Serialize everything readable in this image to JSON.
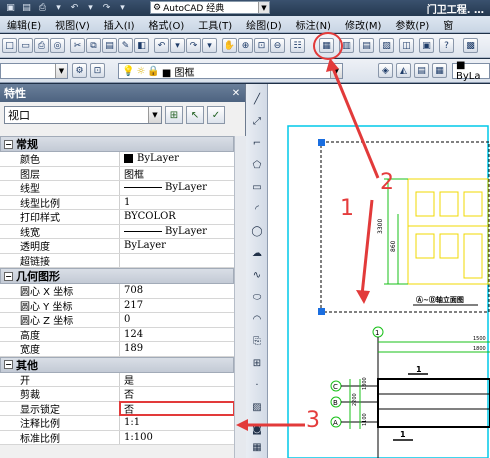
{
  "title_bar": {
    "workspace": "AutoCAD 经典",
    "title": "门卫工程. …"
  },
  "menu": [
    "编辑(E)",
    "视图(V)",
    "插入(I)",
    "格式(O)",
    "工具(T)",
    "绘图(D)",
    "标注(N)",
    "修改(M)",
    "参数(P)",
    "窗"
  ],
  "toolbar2": {
    "layer_name": "■ 图框",
    "right_combo": "■ ByLa"
  },
  "properties": {
    "title": "特性",
    "selected_object": "视口",
    "sections": [
      {
        "name": "常规",
        "rows": [
          {
            "label": "颜色",
            "value": "ByLayer",
            "kind": "swatch"
          },
          {
            "label": "图层",
            "value": "图框"
          },
          {
            "label": "线型",
            "value": "ByLayer",
            "kind": "line"
          },
          {
            "label": "线型比例",
            "value": "1"
          },
          {
            "label": "打印样式",
            "value": "BYCOLOR"
          },
          {
            "label": "线宽",
            "value": "ByLayer",
            "kind": "line"
          },
          {
            "label": "透明度",
            "value": "ByLayer"
          },
          {
            "label": "超链接",
            "value": ""
          }
        ]
      },
      {
        "name": "几何图形",
        "rows": [
          {
            "label": "圆心 X 坐标",
            "value": "708"
          },
          {
            "label": "圆心 Y 坐标",
            "value": "217"
          },
          {
            "label": "圆心 Z 坐标",
            "value": "0"
          },
          {
            "label": "高度",
            "value": "124"
          },
          {
            "label": "宽度",
            "value": "189"
          }
        ]
      },
      {
        "name": "其他",
        "rows": [
          {
            "label": "开",
            "value": "是"
          },
          {
            "label": "剪裁",
            "value": "否"
          },
          {
            "label": "显示锁定",
            "value": "否",
            "highlight": true
          },
          {
            "label": "注释比例",
            "value": "1:1"
          },
          {
            "label": "标准比例",
            "value": "1:100"
          }
        ]
      }
    ]
  },
  "drawing": {
    "elevation_title": "Ⓐ~Ⓓ轴立面图",
    "dim_left": "3300",
    "dim_mid": "860",
    "grid_1": "1",
    "grid_c": "C",
    "grid_b": "B",
    "grid_a": "A",
    "dim_top1": "1500",
    "dim_top2": "1800",
    "label_1a": "1",
    "label_1b": "1",
    "dim_v1": "2200",
    "dim_v2": "1800",
    "dim_v3": "1100"
  },
  "annotations": [
    "1",
    "2",
    "3"
  ],
  "colors": {
    "annotation": "#e23a3a",
    "frame": "#00c8e8",
    "drawing_yellow": "#f0d800",
    "drawing_green": "#18c018"
  }
}
